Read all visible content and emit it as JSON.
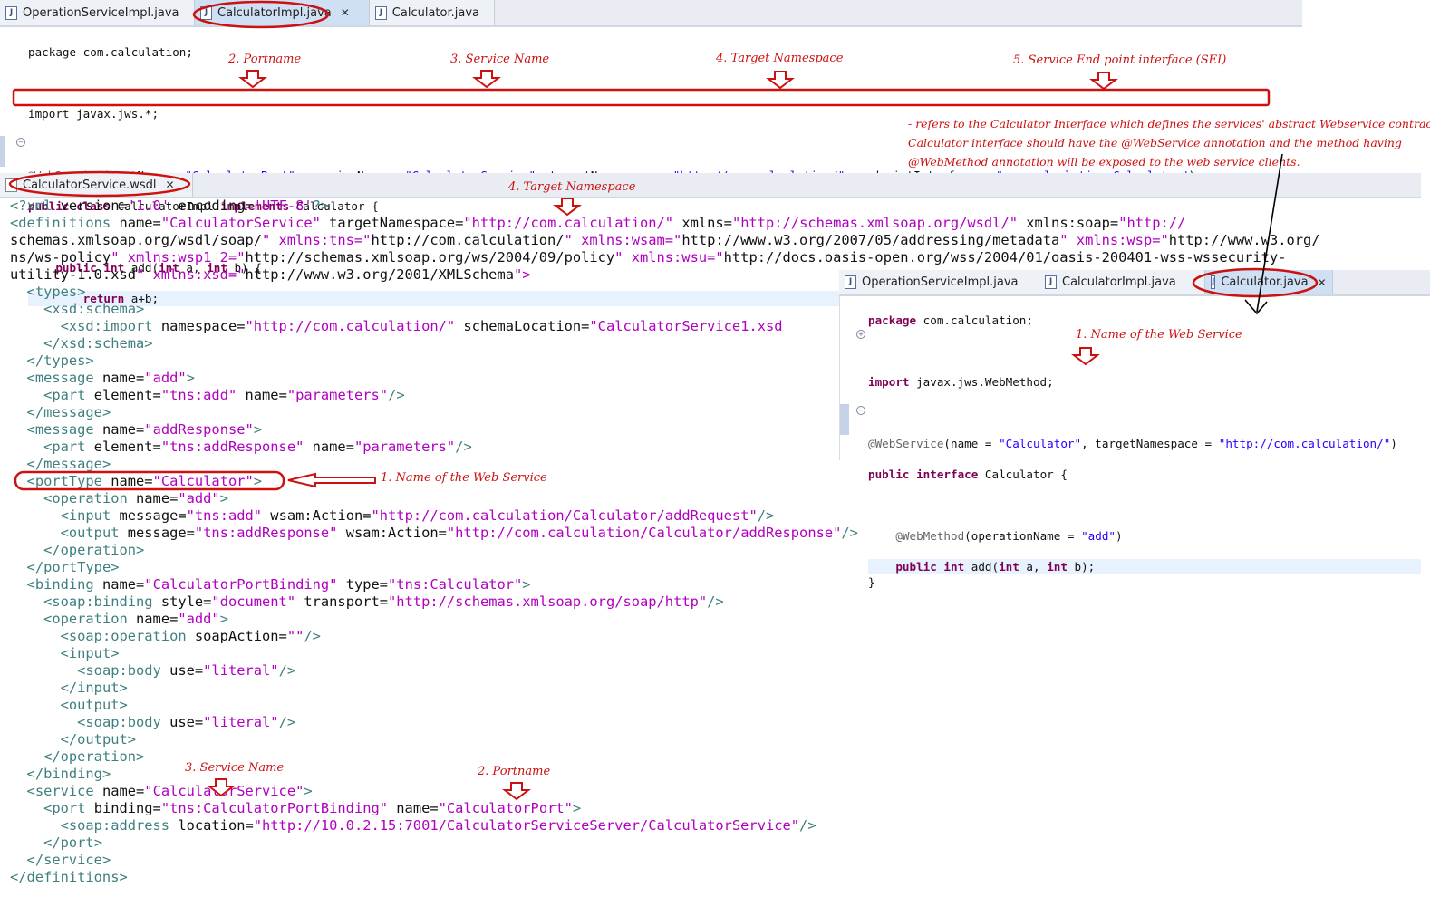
{
  "top_editor": {
    "tabs": [
      {
        "label": "OperationServiceImpl.java"
      },
      {
        "label": "CalculatorImpl.java"
      },
      {
        "label": "Calculator.java"
      }
    ],
    "lines": {
      "l1": "package com.calculation;",
      "l2": "import javax.jws.*;",
      "l3a": "@WebService",
      "l3b": "(portName = ",
      "l3c": "\"CalculatorPort\"",
      "l3d": ", serviceName = ",
      "l3e": "\"CalculatorService\"",
      "l3f": ", targetNamespace = ",
      "l3g": "\"http://com.calculation/\"",
      "l3h": ", endpointInterface = ",
      "l3i": "\"com.calculation.Calculator\"",
      "l3j": ")",
      "l4a": "public class",
      "l4b": " CalculatorImpl ",
      "l4c": "implements",
      "l4d": " Calculator {",
      "l5a": "    ",
      "l5b": "public int",
      "l5c": " add(",
      "l5d": "int",
      "l5e": " a, ",
      "l5f": "int",
      "l5g": " b) {",
      "l6a": "        ",
      "l6b": "return",
      "l6c": " a+b;"
    }
  },
  "wsdl_editor": {
    "tab_label": "CalculatorService.wsdl",
    "lines": [
      "<?xml version='1.0' encoding='UTF-8'?>",
      "<definitions name=\"CalculatorService\" targetNamespace=\"http://com.calculation/\" xmlns=\"http://schemas.xmlsoap.org/wsdl/\" xmlns:soap=\"http://",
      "schemas.xmlsoap.org/wsdl/soap/\" xmlns:tns=\"http://com.calculation/\" xmlns:wsam=\"http://www.w3.org/2007/05/addressing/metadata\" xmlns:wsp=\"http://www.w3.org/",
      "ns/ws-policy\" xmlns:wsp1_2=\"http://schemas.xmlsoap.org/ws/2004/09/policy\" xmlns:wsu=\"http://docs.oasis-open.org/wss/2004/01/oasis-200401-wss-wssecurity-",
      "utility-1.0.xsd\" xmlns:xsd=\"http://www.w3.org/2001/XMLSchema\">",
      "  <types>",
      "    <xsd:schema>",
      "      <xsd:import namespace=\"http://com.calculation/\" schemaLocation=\"CalculatorService1.xsd",
      "    </xsd:schema>",
      "  </types>",
      "  <message name=\"add\">",
      "    <part element=\"tns:add\" name=\"parameters\"/>",
      "  </message>",
      "  <message name=\"addResponse\">",
      "    <part element=\"tns:addResponse\" name=\"parameters\"/>",
      "  </message>",
      "  <portType name=\"Calculator\">",
      "    <operation name=\"add\">",
      "      <input message=\"tns:add\" wsam:Action=\"http://com.calculation/Calculator/addRequest\"/>",
      "      <output message=\"tns:addResponse\" wsam:Action=\"http://com.calculation/Calculator/addResponse\"/>",
      "    </operation>",
      "  </portType>",
      "  <binding name=\"CalculatorPortBinding\" type=\"tns:Calculator\">",
      "    <soap:binding style=\"document\" transport=\"http://schemas.xmlsoap.org/soap/http\"/>",
      "    <operation name=\"add\">",
      "      <soap:operation soapAction=\"\"/>",
      "      <input>",
      "        <soap:body use=\"literal\"/>",
      "      </input>",
      "      <output>",
      "        <soap:body use=\"literal\"/>",
      "      </output>",
      "    </operation>",
      "  </binding>",
      "  <service name=\"CalculatorService\">",
      "    <port binding=\"tns:CalculatorPortBinding\" name=\"CalculatorPort\">",
      "      <soap:address location=\"http://10.0.2.15:7001/CalculatorServiceServer/CalculatorService\"/>",
      "    </port>",
      "  </service>",
      "</definitions>"
    ]
  },
  "interface_editor": {
    "tabs": [
      {
        "label": "OperationServiceImpl.java"
      },
      {
        "label": "CalculatorImpl.java"
      },
      {
        "label": "Calculator.java"
      }
    ],
    "lines": {
      "l1a": "package",
      "l1b": " com.calculation;",
      "l2a": "import",
      "l2b": " javax.jws.WebMethod;",
      "l3a": "@WebService",
      "l3b": "(name = ",
      "l3c": "\"Calculator\"",
      "l3d": ", targetNamespace = ",
      "l3e": "\"http://com.calculation/\"",
      "l3f": ")",
      "l4a": "public interface",
      "l4b": " Calculator {",
      "l5a": "    ",
      "l5b": "@WebMethod",
      "l5c": "(operationName = ",
      "l5d": "\"add\"",
      "l5e": ")",
      "l6a": "    ",
      "l6b": "public int",
      "l6c": " add(",
      "l6d": "int",
      "l6e": " a, ",
      "l6f": "int",
      "l6g": " b);",
      "l7": "}"
    }
  },
  "annotations": {
    "portname": "2. Portname",
    "service_name": "3. Service Name",
    "target_namespace": "4. Target Namespace",
    "sei": "5. Service End point interface (SEI)",
    "sei_note": "- refers to the Calculator Interface which defines the services' abstract Webservice contract.\nCalculator interface should have the @WebService annotation and the method having\n@WebMethod annotation will be exposed to the web service clients.",
    "wsdl_target_namespace": "4. Target Namespace",
    "web_service_name": "1. Name of the Web Service",
    "interface_web_service_name": "1. Name of the Web Service",
    "wsdl_service_name": "3. Service Name",
    "wsdl_portname": "2. Portname"
  },
  "colors": {
    "annotation_red": "#cc1111",
    "tab_active": "#cfe0f4",
    "keyword": "#7f0055",
    "string": "#2a00ff",
    "xml_tag": "#3f7f7f",
    "xml_attr": "#7f007f",
    "xml_value": "#b100c0"
  }
}
